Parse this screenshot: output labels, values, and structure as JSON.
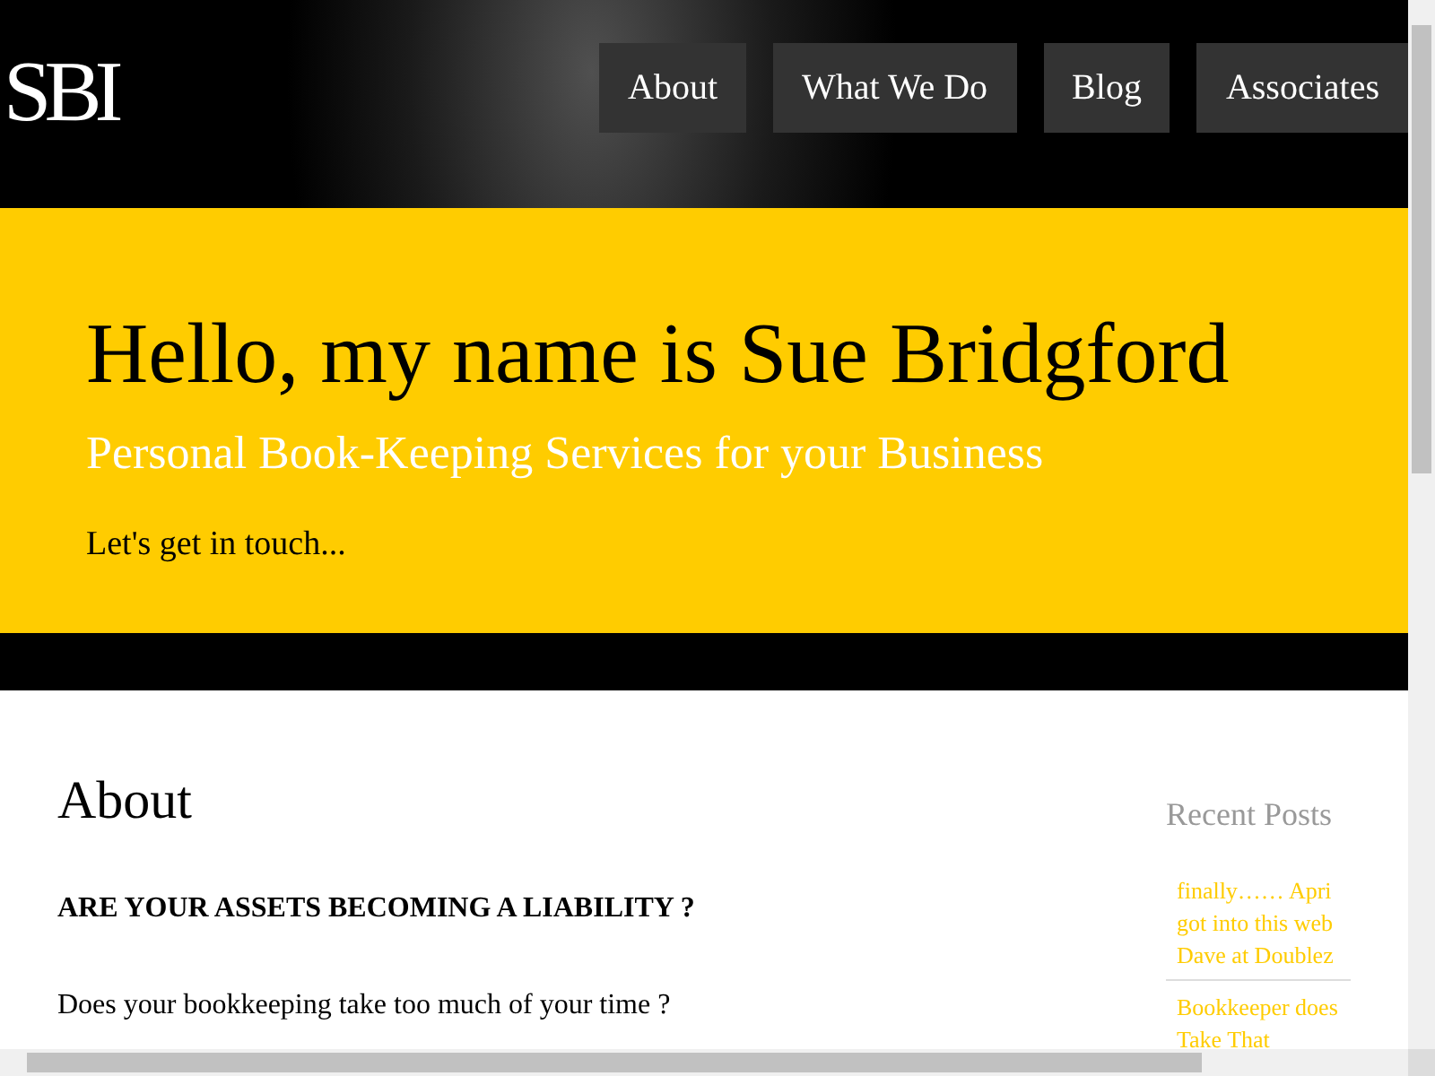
{
  "header": {
    "logo": "SBI",
    "nav": [
      {
        "label": "About"
      },
      {
        "label": "What We Do"
      },
      {
        "label": "Blog"
      },
      {
        "label": "Associates"
      }
    ]
  },
  "hero": {
    "title": "Hello, my name is Sue Bridgford",
    "subtitle": "Personal Book-Keeping Services for your Business",
    "cta": "Let's get in touch..."
  },
  "main": {
    "heading": "About",
    "subheading": "ARE YOUR ASSETS BECOMING A LIABILITY ?",
    "paragraph": "Does your bookkeeping take too much of your time ?"
  },
  "sidebar": {
    "heading": "Recent Posts",
    "posts": [
      {
        "lines": [
          "finally…… Apri",
          "got into this web",
          "Dave at Doublez"
        ]
      },
      {
        "lines": [
          "Bookkeeper does",
          "Take That"
        ]
      }
    ]
  }
}
